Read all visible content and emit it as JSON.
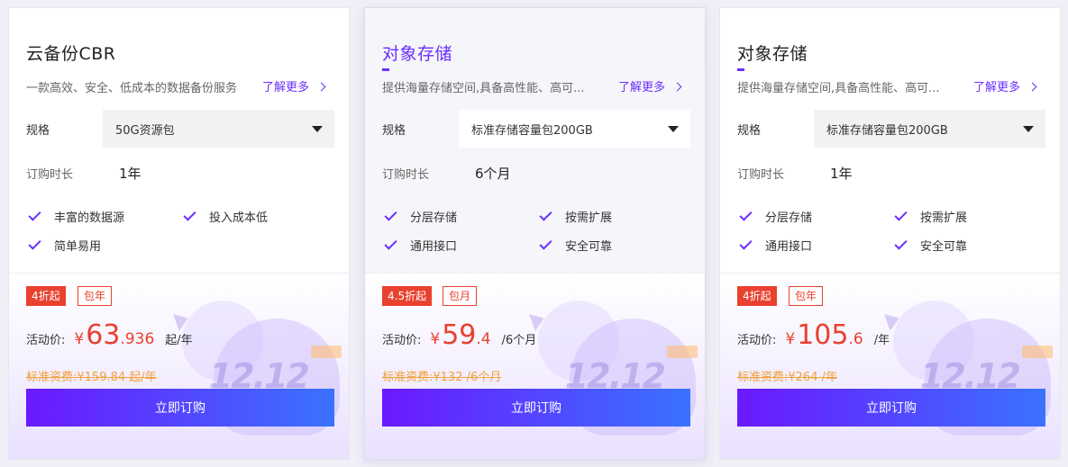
{
  "cards": [
    {
      "title": "云备份CBR",
      "description": "一款高效、安全、低成本的数据备份服务",
      "learn_more": "了解更多",
      "spec_label": "规格",
      "spec_value": "50G资源包",
      "duration_label": "订购时长",
      "duration_value": "1年",
      "features": [
        "丰富的数据源",
        "投入成本低",
        "简单易用"
      ],
      "discount_badge": "4折起",
      "period_badge": "包年",
      "price_label": "活动价:",
      "currency": "¥",
      "price_int": "63",
      "price_dec": ".936",
      "price_unit": "起/年",
      "standard_price": "标准资费:¥159.84 起/年",
      "buy_label": "立即订购"
    },
    {
      "title": "对象存储",
      "description": "提供海量存储空间,具备高性能、高可...",
      "learn_more": "了解更多",
      "spec_label": "规格",
      "spec_value": "标准存储容量包200GB",
      "duration_label": "订购时长",
      "duration_value": "6个月",
      "features": [
        "分层存储",
        "按需扩展",
        "通用接口",
        "安全可靠"
      ],
      "discount_badge": "4.5折起",
      "period_badge": "包月",
      "price_label": "活动价:",
      "currency": "¥",
      "price_int": "59",
      "price_dec": ".4",
      "price_unit": "/6个月",
      "standard_price": "标准资费:¥132 /6个月",
      "buy_label": "立即订购"
    },
    {
      "title": "对象存储",
      "description": "提供海量存储空间,具备高性能、高可...",
      "learn_more": "了解更多",
      "spec_label": "规格",
      "spec_value": "标准存储容量包200GB",
      "duration_label": "订购时长",
      "duration_value": "1年",
      "features": [
        "分层存储",
        "按需扩展",
        "通用接口",
        "安全可靠"
      ],
      "discount_badge": "4折起",
      "period_badge": "包年",
      "price_label": "活动价:",
      "currency": "¥",
      "price_int": "105",
      "price_dec": ".6",
      "price_unit": "/年",
      "standard_price": "标准资费:¥264 /年",
      "buy_label": "立即订购"
    }
  ],
  "colors": {
    "accent": "#6b2fff",
    "price": "#e8412f",
    "standard_price": "#f0a23c",
    "button_start": "#6b19ff",
    "button_end": "#3a72ff"
  },
  "icons": [
    "chevron-right-icon",
    "caret-down-icon",
    "check-icon"
  ],
  "deco_text": "12.12"
}
